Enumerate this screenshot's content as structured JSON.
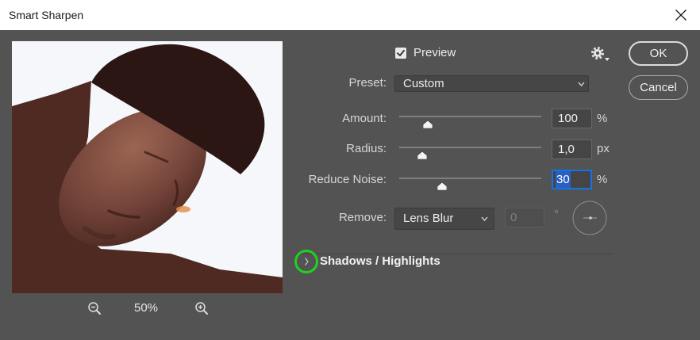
{
  "window": {
    "title": "Smart Sharpen",
    "close_icon": "close-icon"
  },
  "preview_pane": {
    "zoom_level": "50%",
    "zoom_out_icon": "zoom-out-icon",
    "zoom_in_icon": "zoom-in-icon"
  },
  "preview_toggle": {
    "label": "Preview",
    "checked": true
  },
  "settings_menu": {
    "icon": "gear-icon"
  },
  "buttons": {
    "ok": "OK",
    "cancel": "Cancel"
  },
  "preset": {
    "label": "Preset:",
    "value": "Custom"
  },
  "amount": {
    "label": "Amount:",
    "value": "100",
    "unit": "%",
    "slider_fraction": 0.2
  },
  "radius": {
    "label": "Radius:",
    "value": "1,0",
    "unit": "px",
    "slider_fraction": 0.16
  },
  "reduce_noise": {
    "label": "Reduce Noise:",
    "value": "30",
    "unit": "%",
    "slider_fraction": 0.3,
    "focused": true
  },
  "remove": {
    "label": "Remove:",
    "value": "Lens Blur",
    "angle_value": "0",
    "angle_unit": "°",
    "angle_enabled": false
  },
  "shadows_highlights": {
    "label": "Shadows / Highlights",
    "expanded": false
  },
  "colors": {
    "panel": "#535353",
    "title_bar": "#ffffff",
    "accent": "#1473e6",
    "selection": "#2a5fc4",
    "highlight_ring": "#1fd21f"
  }
}
